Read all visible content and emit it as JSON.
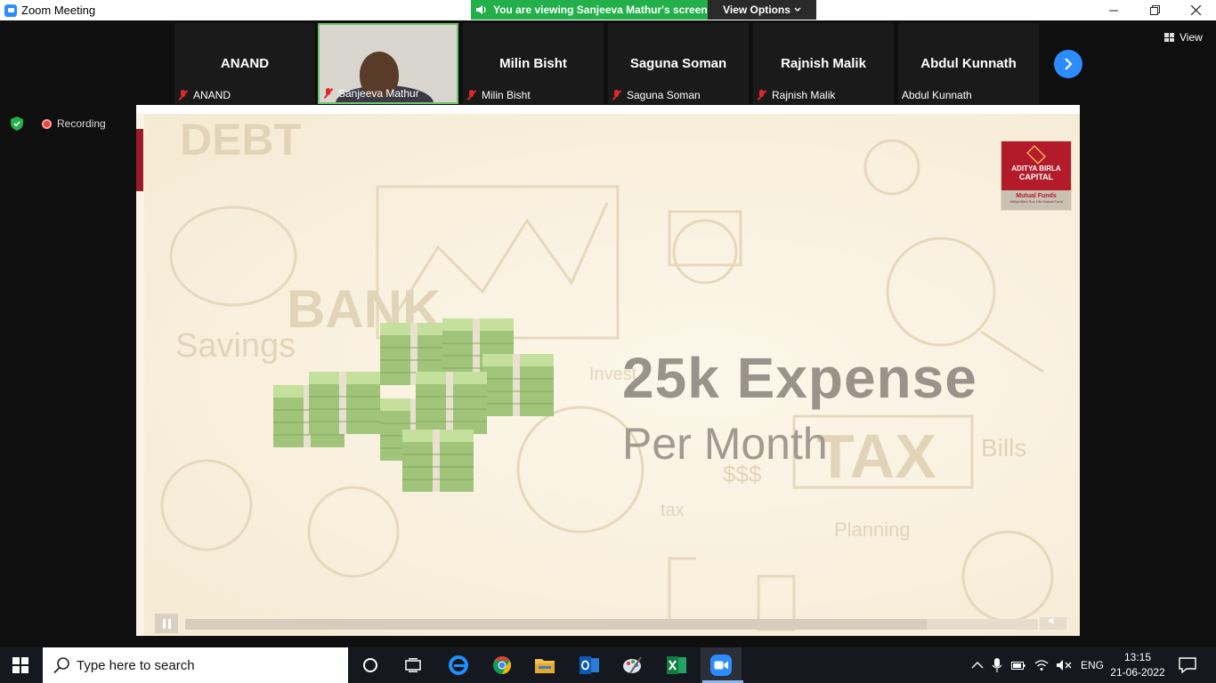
{
  "window": {
    "title": "Zoom Meeting"
  },
  "share_banner": {
    "text": "You are viewing Sanjeeva Mathur's screen",
    "options_label": "View Options"
  },
  "view_button": {
    "label": "View"
  },
  "participants": [
    {
      "display_name": "ANAND",
      "label": "ANAND",
      "muted": true
    },
    {
      "display_name": "",
      "label": "Sanjeeva Mathur",
      "muted": true
    },
    {
      "display_name": "Milin Bisht",
      "label": "Milin Bisht",
      "muted": true
    },
    {
      "display_name": "Saguna Soman",
      "label": "Saguna Soman",
      "muted": true
    },
    {
      "display_name": "Rajnish Malik",
      "label": "Rajnish Malik",
      "muted": true
    },
    {
      "display_name": "Abdul Kunnath",
      "label": "Abdul Kunnath",
      "muted": false
    }
  ],
  "recording": {
    "label": "Recording"
  },
  "slide": {
    "headline": "25k Expense",
    "subline": "Per Month",
    "bg_words": [
      "Savings",
      "BANK",
      "TAX",
      "Bills",
      "Planning",
      "tax",
      "$$$",
      "DEBT",
      "Invest"
    ],
    "logo": {
      "line1": "ADITYA BIRLA",
      "line2": "CAPITAL",
      "line3": "Mutual Funds",
      "line4": "Aditya Birla Sun Life Mutual Fund"
    },
    "video_progress": 0.87
  },
  "taskbar": {
    "search_placeholder": "Type here to search",
    "language": "ENG",
    "time": "13:15",
    "date": "21-06-2022"
  },
  "colors": {
    "zoom_blue": "#2d8cff",
    "share_green": "#23b04a",
    "brand_red": "#b31b2b"
  }
}
